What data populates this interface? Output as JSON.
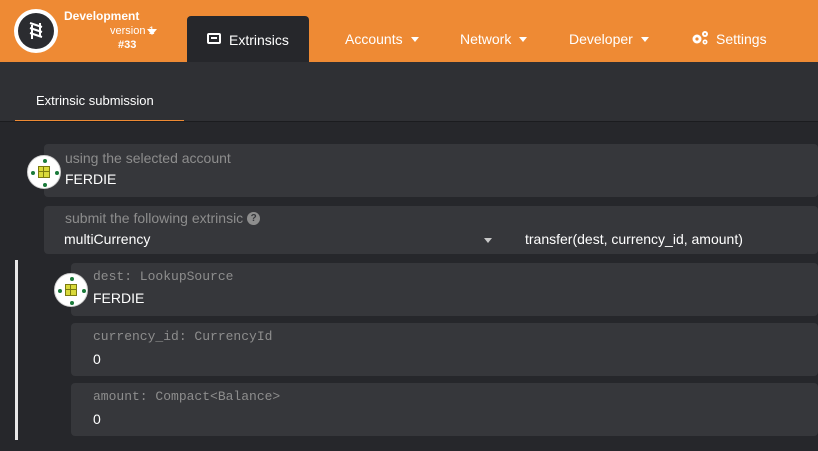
{
  "header": {
    "chain_name": "Development",
    "chain_version": "version 1",
    "chain_block": "#33",
    "nav_active_label": "Extrinsics",
    "nav_items": [
      {
        "label": "Accounts"
      },
      {
        "label": "Network"
      },
      {
        "label": "Developer"
      }
    ],
    "settings_label": "Settings",
    "brand_color": "#ee8a34"
  },
  "subnav": {
    "active_tab": "Extrinsic submission"
  },
  "form": {
    "account": {
      "label": "using the selected account",
      "value": "FERDIE"
    },
    "extrinsic": {
      "label": "submit the following extrinsic",
      "section": "multiCurrency",
      "method": "transfer(dest, currency_id, amount)"
    },
    "params": [
      {
        "label": "dest: LookupSource",
        "value": "FERDIE"
      },
      {
        "label": "currency_id: CurrencyId",
        "value": "0"
      },
      {
        "label": "amount: Compact<Balance>",
        "value": "0"
      }
    ]
  },
  "icons": {
    "logo": "substrate-logo-icon",
    "extrinsics": "file-code-icon",
    "settings": "cogs-icon",
    "help": "question-circle-icon",
    "identicon": "identicon-icon"
  }
}
